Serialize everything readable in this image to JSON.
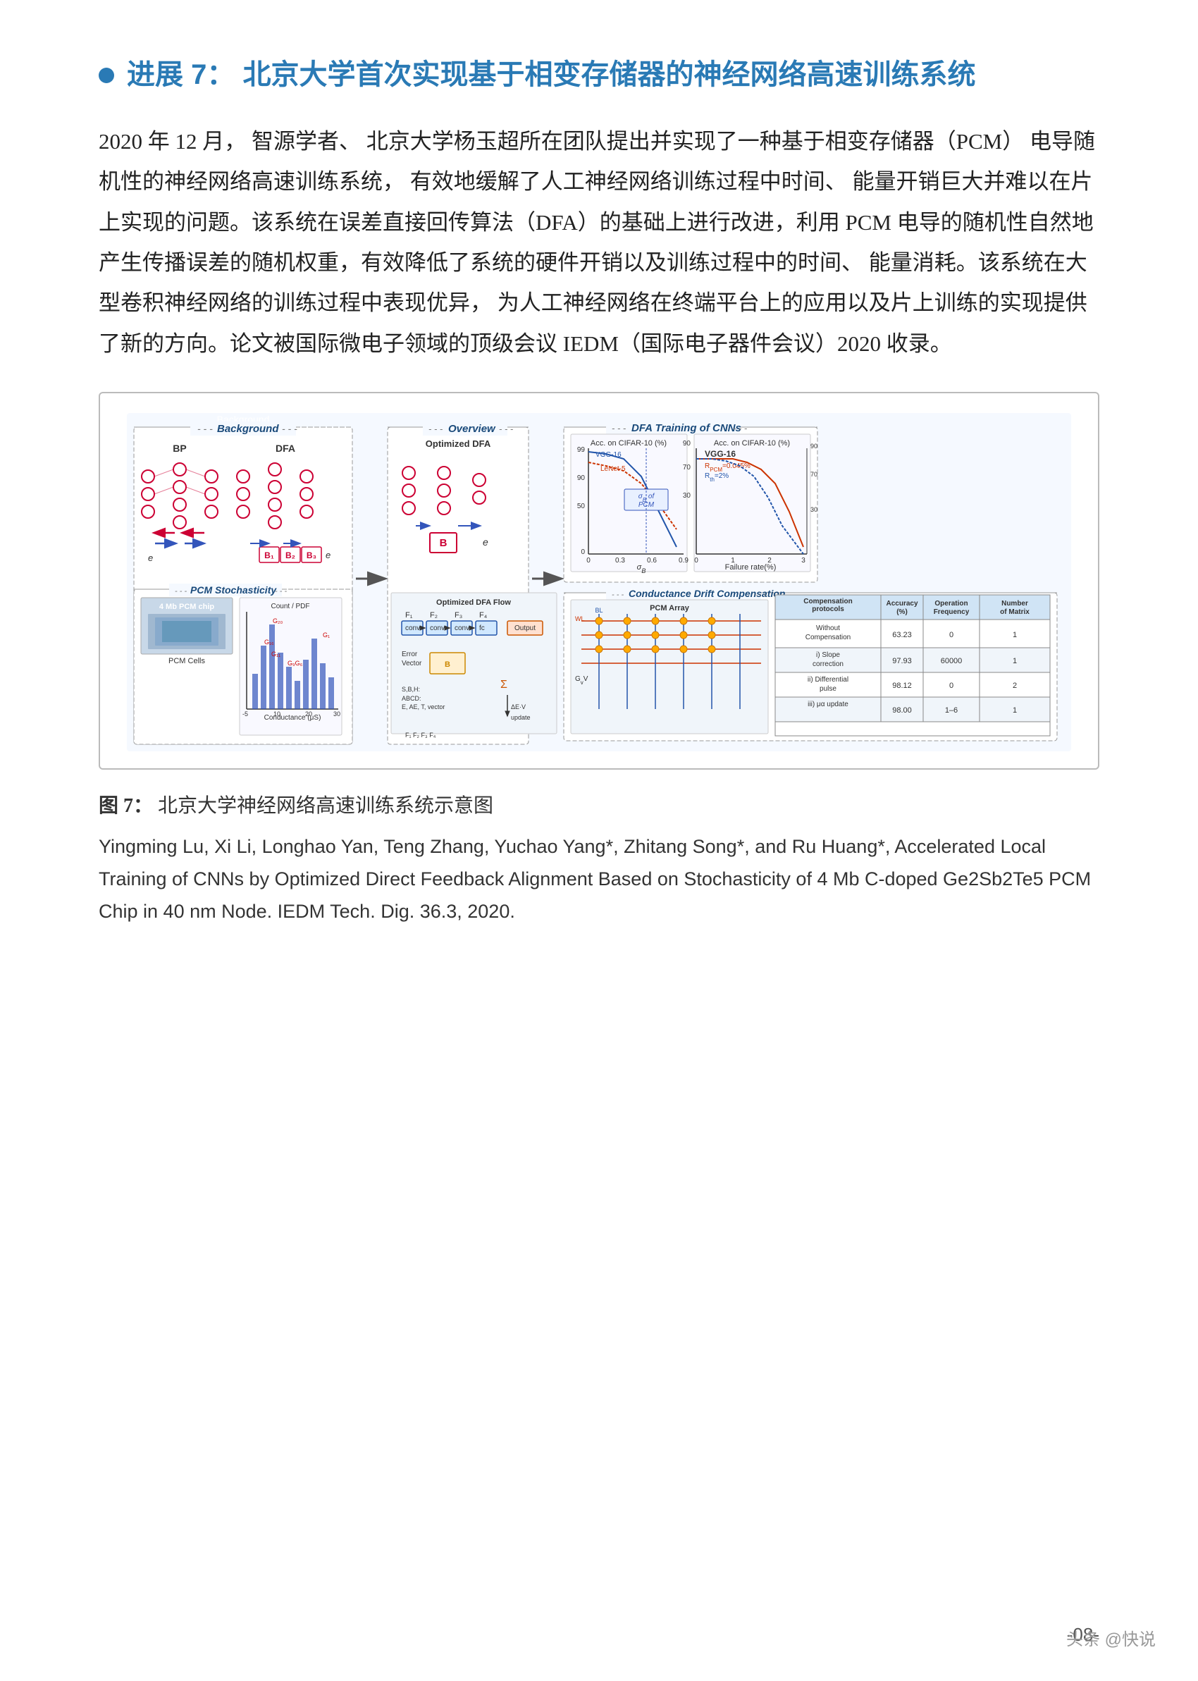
{
  "section": {
    "number": "7",
    "title": "进展 7：  北京大学首次实现基于相变存储器的神经网络高速训练系统"
  },
  "body_paragraph": "2020 年 12 月，  智源学者、  北京大学杨玉超所在团队提出并实现了一种基于相变存储器（PCM）  电导随机性的神经网络高速训练系统，  有效地缓解了人工神经网络训练过程中时间、  能量开销巨大并难以在片上实现的问题。该系统在误差直接回传算法（DFA）的基础上进行改进，利用 PCM 电导的随机性自然地产生传播误差的随机权重，有效降低了系统的硬件开销以及训练过程中的时间、  能量消耗。该系统在大型卷积神经网络的训练过程中表现优异，  为人工神经网络在终端平台上的应用以及片上训练的实现提供了新的方向。论文被国际微电子领域的顶级会议 IEDM（国际电子器件会议）2020 收录。",
  "figure": {
    "caption_label": "图 7：",
    "caption_text": "  北京大学神经网络高速训练系统示意图",
    "panels": {
      "background": {
        "title": "Background",
        "items": [
          "BP",
          "DFA"
        ]
      },
      "overview": {
        "title": "Overview",
        "subtitle": "Optimized DFA"
      },
      "dfa_training": {
        "title": "DFA Training of  CNNs"
      },
      "pcm_stochasticity": {
        "title": "PCM Stochasticity",
        "chip_label": "4 Mb PCM chip",
        "cell_label": "PCM Cells"
      },
      "conductance_drift": {
        "title": "Conductance Drift Compensation"
      }
    }
  },
  "reference": {
    "authors": "Yingming Lu, Xi Li, Longhao Yan, Teng Zhang, Yuchao Yang*, Zhitang Song*, and Ru Huang*,",
    "title": "Accelerated Local Training of CNNs by Optimized Direct Feedback Alignment Based on Stochasticity of 4 Mb C-doped Ge2Sb2Te5 PCM Chip in 40 nm Node.",
    "journal": "IEDM Tech. Dig. 36.3, 2020."
  },
  "table": {
    "headers": [
      "Compensation protocols",
      "Accuracy (%)",
      "Operation Frequency",
      "Number of Matrix"
    ],
    "rows": [
      [
        "Without Compensation",
        "63.23",
        "0",
        "1"
      ],
      [
        "i) Slope correction",
        "97.93",
        "60000",
        "1"
      ],
      [
        "ii) Differential pulse",
        "98.12",
        "0",
        "2"
      ],
      [
        "iii) μα update",
        "98.00",
        "1–6",
        "1"
      ]
    ]
  },
  "page_number": "-08-",
  "watermark": "头条 @快说"
}
